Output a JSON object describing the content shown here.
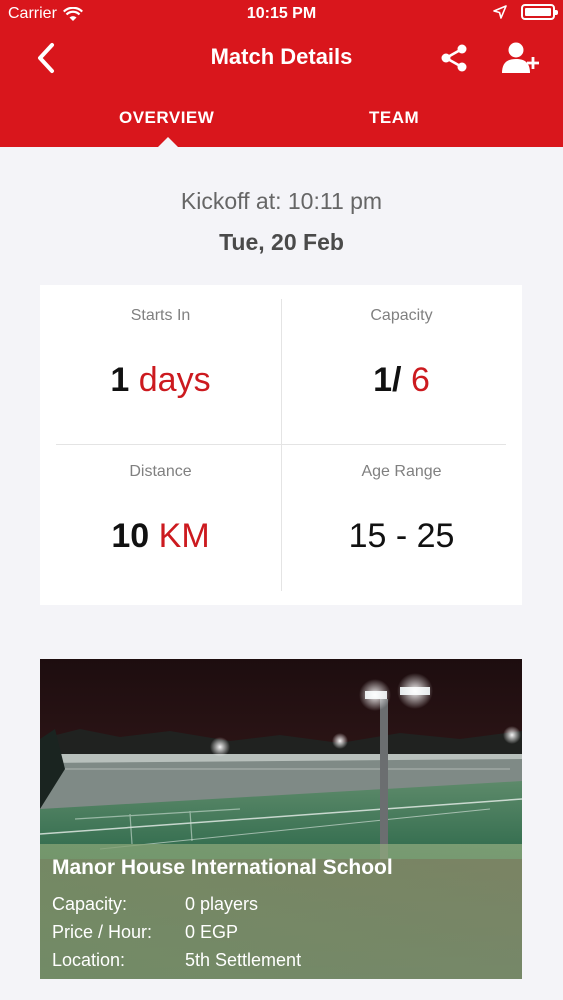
{
  "status_bar": {
    "carrier": "Carrier",
    "time": "10:15 PM"
  },
  "nav": {
    "title": "Match Details"
  },
  "tabs": [
    {
      "label": "OVERVIEW",
      "active": true
    },
    {
      "label": "TEAM",
      "active": false
    }
  ],
  "kickoff": {
    "text": "Kickoff at: 10:11 pm",
    "date": "Tue, 20 Feb"
  },
  "stats": {
    "starts_in": {
      "label": "Starts In",
      "number": "1",
      "unit": "days"
    },
    "capacity": {
      "label": "Capacity",
      "current": "1",
      "separator": "/",
      "max": "6"
    },
    "distance": {
      "label": "Distance",
      "number": "10",
      "unit": "KM"
    },
    "age_range": {
      "label": "Age Range",
      "value": "15 - 25"
    }
  },
  "venue": {
    "name": "Manor House International School",
    "details": [
      {
        "key": "Capacity:",
        "value": "0 players"
      },
      {
        "key": "Price / Hour:",
        "value": "0 EGP"
      },
      {
        "key": "Location:",
        "value": "5th Settlement"
      }
    ]
  },
  "colors": {
    "brand_red": "#d9161c",
    "accent_red": "#cc1a1f",
    "background": "#f4f4f8"
  },
  "icons": [
    "wifi-icon",
    "location-arrow-icon",
    "battery-icon",
    "back-chevron-icon",
    "share-icon",
    "add-user-icon"
  ]
}
